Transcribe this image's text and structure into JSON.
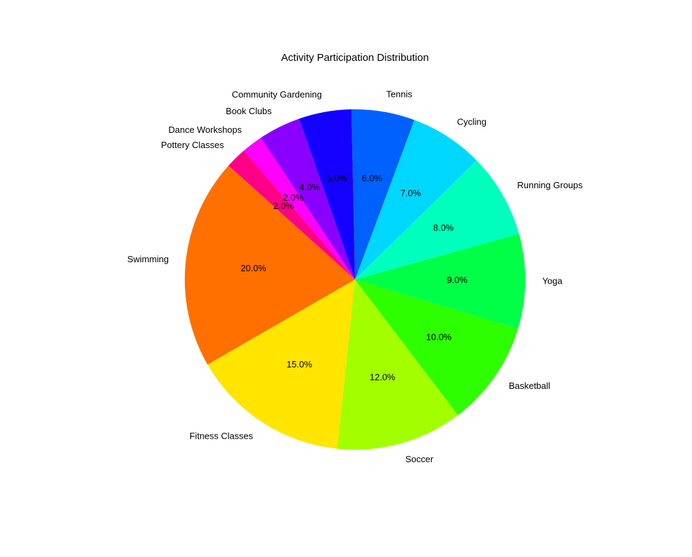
{
  "chart_data": {
    "type": "pie",
    "title": "Activity Participation Distribution",
    "categories": [
      "Swimming",
      "Fitness Classes",
      "Soccer",
      "Basketball",
      "Yoga",
      "Running Groups",
      "Cycling",
      "Tennis",
      "Community Gardening",
      "Book Clubs",
      "Dance Workshops",
      "Pottery Classes"
    ],
    "values": [
      20,
      15,
      12,
      10,
      9,
      8,
      7,
      6,
      5,
      4,
      2,
      2
    ],
    "percent_labels": [
      "20.0%",
      "15.0%",
      "12.0%",
      "10.0%",
      "9.0%",
      "8.0%",
      "7.0%",
      "6.0%",
      "5.0%",
      "4.0%",
      "2.0%",
      "2.0%"
    ],
    "colors": [
      "#ff7000",
      "#ffe500",
      "#a3ff00",
      "#2eff00",
      "#00ff47",
      "#00ffbc",
      "#00d7ff",
      "#0061ff",
      "#1400ff",
      "#8a00ff",
      "#ff00ff",
      "#ff0088"
    ],
    "start_angle_deg": 138,
    "direction": "counterclockwise"
  }
}
